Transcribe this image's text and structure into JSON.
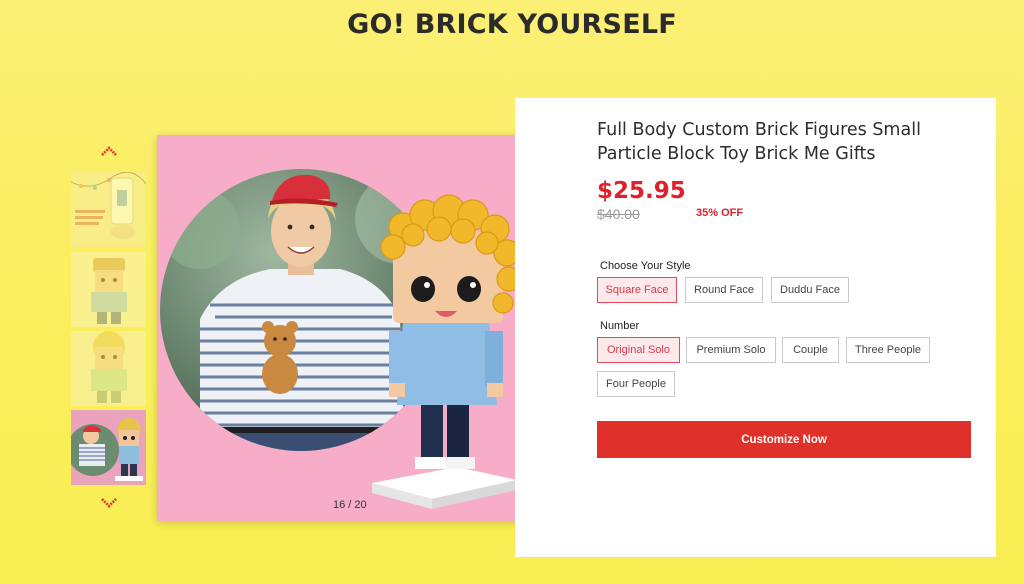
{
  "header": {
    "title": "GO! BRICK YOURSELF"
  },
  "gallery": {
    "counter": "16 / 20",
    "up_icon": "chevron-up-icon",
    "down_icon": "chevron-down-icon"
  },
  "product": {
    "title": "Full Body Custom Brick Figures Small Particle Block Toy Brick Me Gifts",
    "price": "$25.95",
    "original_price": "$40.00",
    "discount": "35% OFF",
    "style_label": "Choose Your Style",
    "style_options": [
      "Square Face",
      "Round Face",
      "Duddu Face"
    ],
    "style_selected": "Square Face",
    "number_label": "Number",
    "number_options": [
      "Original Solo",
      "Premium Solo",
      "Couple",
      "Three People",
      "Four People"
    ],
    "number_selected": "Original Solo",
    "cta_label": "Customize Now"
  },
  "colors": {
    "background": "#fbef62",
    "accent": "#e0302a",
    "price": "#e0202b",
    "selected_border": "#e4495a",
    "image_bg": "#f7adc7"
  }
}
